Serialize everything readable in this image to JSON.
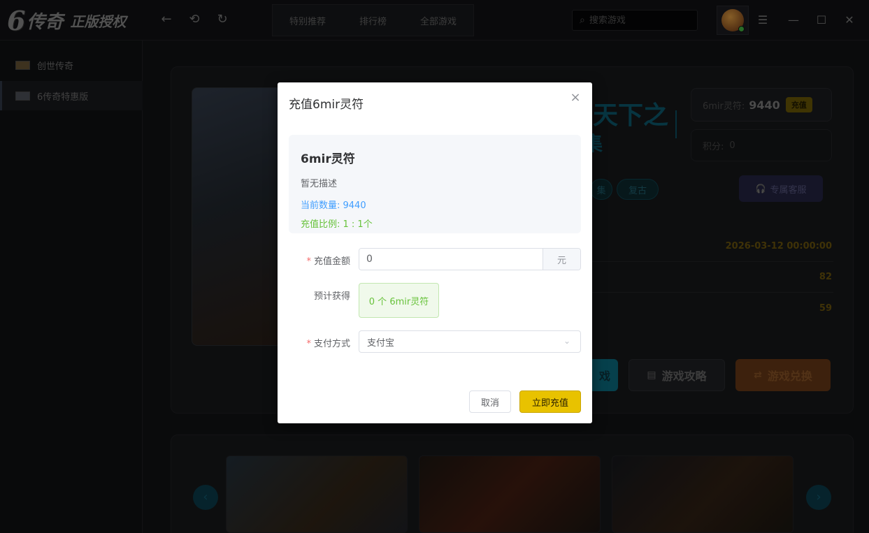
{
  "logo": {
    "six": "6",
    "name": "传奇",
    "sub": "正版授权"
  },
  "nav": {
    "back_icon": "←",
    "refresh_icon": "⟲",
    "reload_icon": "↻"
  },
  "header": {
    "tabs": [
      "特别推荐",
      "排行榜",
      "全部游戏"
    ]
  },
  "search": {
    "placeholder": "搜索游戏",
    "icon": "⌕"
  },
  "window": {
    "menu_icon": "☰",
    "min_icon": "—",
    "max_icon": "☐",
    "close_icon": "✕"
  },
  "sidebar": {
    "items": [
      {
        "label": "创世传奇"
      },
      {
        "label": "6传奇特惠版"
      }
    ]
  },
  "game": {
    "title_line1": "天下之",
    "title_line2": "集",
    "tags": [
      "复古"
    ],
    "tag_partial": "集",
    "currency_label": "6mir灵符:",
    "currency_value": "9440",
    "recharge_badge": "充值",
    "points_label": "积分:",
    "points_value": "0",
    "service_label": "专属客服",
    "service_icon": "🎧",
    "date": "2026-03-12 00:00:00",
    "stat1": "82",
    "stat2": "59",
    "play_label_partial": "戏",
    "guide_label": "游戏攻略",
    "guide_icon": "▤",
    "exchange_label": "游戏兑换",
    "exchange_icon": "⇄",
    "prev_icon": "‹",
    "next_icon": "›"
  },
  "dialog": {
    "title": "充值6mir灵符",
    "close_icon": "×",
    "item_name": "6mir灵符",
    "item_desc": "暂无描述",
    "current_qty": "当前数量: 9440",
    "ratio": "充值比例: 1 : 1个",
    "amount_label": "充值金额",
    "amount_value": "0",
    "amount_unit": "元",
    "estimate_label": "预计获得",
    "estimate_value": "0 个 6mir灵符",
    "pay_label": "支付方式",
    "pay_value": "支付宝",
    "required_mark": "*",
    "chevron_icon": "⌄",
    "cancel_label": "取消",
    "confirm_label": "立即充值"
  }
}
